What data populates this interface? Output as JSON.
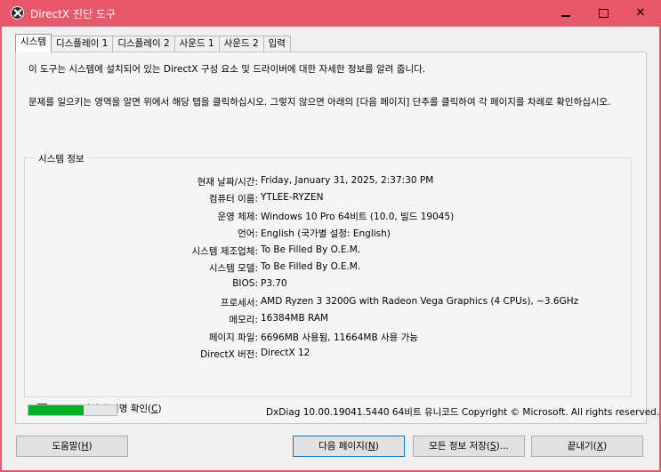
{
  "window": {
    "title": "DirectX 진단 도구"
  },
  "tabs": [
    {
      "label": "시스템",
      "active": true
    },
    {
      "label": "디스플레이 1"
    },
    {
      "label": "디스플레이 2"
    },
    {
      "label": "사운드 1"
    },
    {
      "label": "사운드 2"
    },
    {
      "label": "입력"
    }
  ],
  "intro": {
    "line1": "이 도구는 시스템에 설치되어 있는 DirectX 구성 요소 및 드라이버에 대한 자세한 정보를 알려 줍니다.",
    "line2": "문제를 일으키는 영역을 알면 위에서 해당 탭을 클릭하십시오. 그렇지 않으면 아래의 [다음 페이지] 단추를 클릭하여 각 페이지를 차례로 확인하십시오."
  },
  "system_info": {
    "group_label": "시스템 정보",
    "rows": [
      {
        "label": "현재 날짜/시간:",
        "value": "Friday, January 31, 2025, 2:37:30 PM"
      },
      {
        "label": "컴퓨터 이름:",
        "value": "YTLEE-RYZEN"
      },
      {
        "label": "운영 체제:",
        "value": "Windows 10 Pro 64비트 (10.0, 빌드 19045)"
      },
      {
        "label": "언어:",
        "value": "English (국가별 설정: English)"
      },
      {
        "label": "시스템 제조업체:",
        "value": "To Be Filled By O.E.M."
      },
      {
        "label": "시스템 모델:",
        "value": "To Be Filled By O.E.M."
      },
      {
        "label": "BIOS:",
        "value": "P3.70"
      },
      {
        "label": "프로세서:",
        "value": "AMD Ryzen 3 3200G with Radeon Vega Graphics      (4 CPUs), ~3.6GHz"
      },
      {
        "label": "메모리:",
        "value": "16384MB RAM"
      },
      {
        "label": "페이지 파일:",
        "value": "6696MB 사용됨, 11664MB 사용 가능"
      },
      {
        "label": "DirectX 버전:",
        "value": "DirectX 12"
      }
    ]
  },
  "whql": {
    "label": "WHQL 디지털 서명 확인(",
    "accel": "C",
    "suffix": ")",
    "checked": true
  },
  "progress": {
    "fraction": 0.63,
    "color": "#06b025"
  },
  "status_text": "DxDiag 10.00.19041.5440 64비트 유니코드  Copyright © Microsoft. All rights reserved.",
  "buttons": {
    "help": {
      "pre": "도움말(",
      "accel": "H",
      "post": ")"
    },
    "next": {
      "pre": "다음 페이지(",
      "accel": "N",
      "post": ")"
    },
    "save": {
      "pre": "모든 정보 저장(",
      "accel": "S",
      "post": ")..."
    },
    "exit": {
      "pre": "끝내기(",
      "accel": "X",
      "post": ")"
    }
  },
  "colors": {
    "titlebar": "#e9576a",
    "accent": "#0078d7"
  }
}
